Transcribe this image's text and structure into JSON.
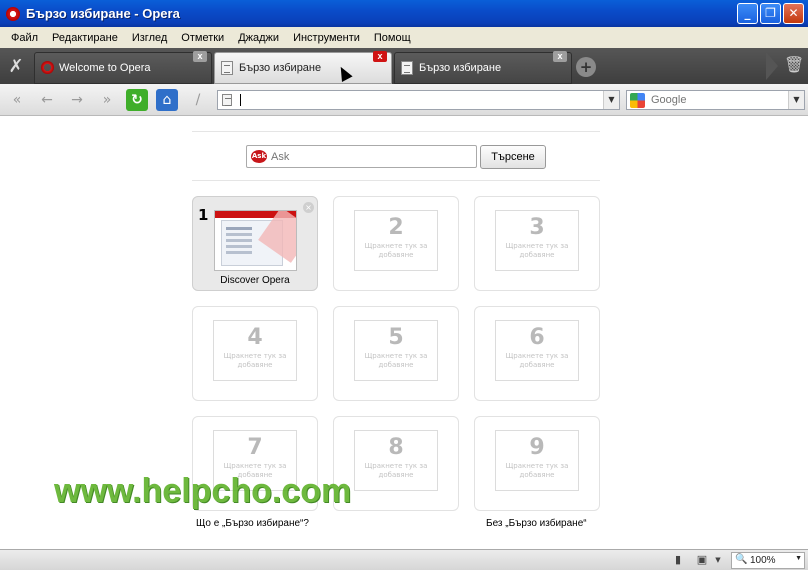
{
  "window": {
    "title": "Бързо избиране - Opera",
    "minimize_label": "_",
    "maximize_label": "❐",
    "close_label": "✕"
  },
  "menu": [
    "Файл",
    "Редактиране",
    "Изглед",
    "Отметки",
    "Джаджи",
    "Инструменти",
    "Помощ"
  ],
  "tabs": [
    {
      "label": "Welcome to Opera",
      "icon": "opera-icon",
      "close": "x"
    },
    {
      "label": "Бързо избиране",
      "icon": "page-icon",
      "close": "x",
      "active": true
    },
    {
      "label": "Бързо избиране",
      "icon": "page-icon",
      "close": "x"
    }
  ],
  "tabbar": {
    "new_tab": "+",
    "trash": "🗑",
    "tools": "✗"
  },
  "toolbar": {
    "rewind": "«",
    "back": "←",
    "forward": "→",
    "fast_forward": "»",
    "reload": "↻",
    "home": "⌂",
    "edit": "/",
    "address_value": "",
    "search_placeholder": "Google",
    "dropdown": "▼"
  },
  "speed_dial": {
    "search_placeholder": "Ask",
    "search_engine_icon": "Ask",
    "search_button": "Търсене",
    "filled": {
      "index": "1",
      "title": "Discover Opera",
      "close": "×"
    },
    "empty": [
      {
        "num": "2",
        "hint": "Щракнете тук за добавяне"
      },
      {
        "num": "3",
        "hint": "Щракнете тук за добавяне"
      },
      {
        "num": "4",
        "hint": "Щракнете тук за добавяне"
      },
      {
        "num": "5",
        "hint": "Щракнете тук за добавяне"
      },
      {
        "num": "6",
        "hint": "Щракнете тук за добавяне"
      },
      {
        "num": "7",
        "hint": "Щракнете тук за добавяне"
      },
      {
        "num": "8",
        "hint": "Щракнете тук за добавяне"
      },
      {
        "num": "9",
        "hint": "Щракнете тук за добавяне"
      }
    ],
    "what_is": "Що е „Бързо избиране“?",
    "without": "Без „Бързо избиране“"
  },
  "watermark": "www.helpcho.com",
  "statusbar": {
    "zoom": "100%",
    "zoom_icon": "🔍",
    "dropdown": "▼",
    "device_icon": "▮",
    "camera_icon": "▣"
  },
  "colors": {
    "titlebar": "#0a4cc9",
    "active_close": "#d01414",
    "reload": "#3fae2a",
    "home": "#2f6fc9",
    "watermark": "#5fb22a"
  }
}
